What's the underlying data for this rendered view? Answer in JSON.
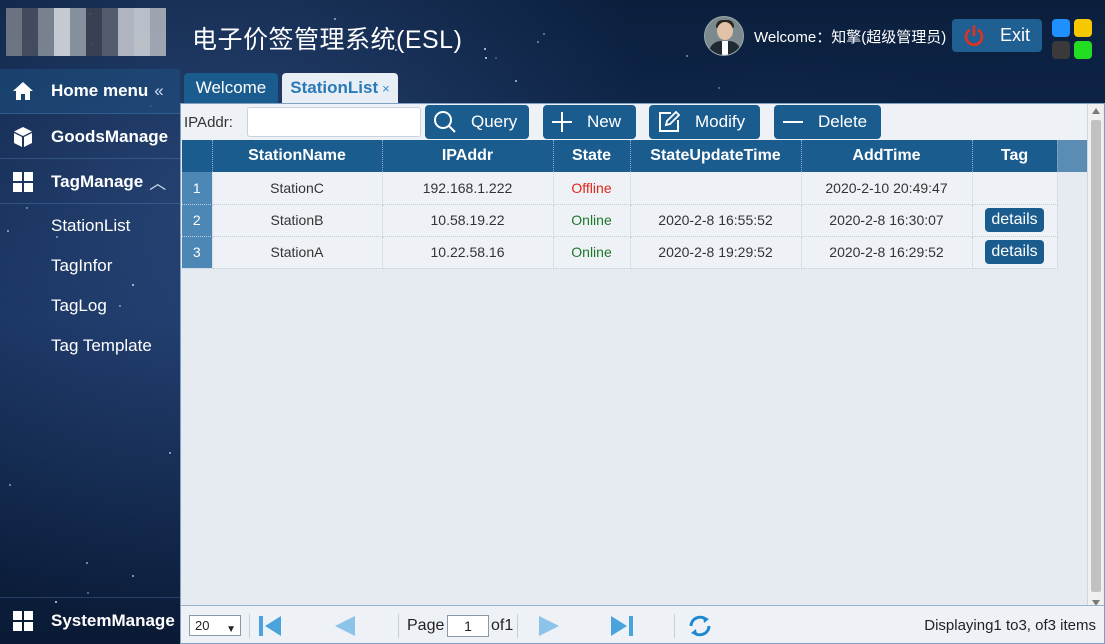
{
  "header": {
    "app_title": "电子价签管理系统(ESL)",
    "welcome_text": "Welcome：知擎(超级管理员)",
    "exit_label": "Exit",
    "theme_colors": [
      "#1e90ff",
      "#f7c800",
      "#3a3a3a",
      "#22dd22"
    ]
  },
  "sidebar": {
    "home_label": "Home menu",
    "home_arrow": "«",
    "goods_label": "GoodsManage",
    "tag_label": "TagManage",
    "tag_arrow": "︿",
    "sub_items": [
      "StationList",
      "TagInfor",
      "TagLog",
      "Tag Template"
    ],
    "system_label": "SystemManage"
  },
  "tabs": {
    "welcome": "Welcome",
    "active": "StationList",
    "close_glyph": "×"
  },
  "toolbar": {
    "ipaddr_label": "IPAddr:",
    "ipaddr_value": "",
    "query_label": "Query",
    "new_label": "New",
    "modify_label": "Modify",
    "delete_label": "Delete"
  },
  "table": {
    "columns": [
      "StationName",
      "IPAddr",
      "State",
      "StateUpdateTime",
      "AddTime",
      "Tag"
    ],
    "rows": [
      {
        "num": "1",
        "name": "StationC",
        "ip": "192.168.1.222",
        "state": "Offline",
        "state_update": "",
        "add_time": "2020-2-10 20:49:47",
        "tag": ""
      },
      {
        "num": "2",
        "name": "StationB",
        "ip": "10.58.19.22",
        "state": "Online",
        "state_update": "2020-2-8 16:55:52",
        "add_time": "2020-2-8 16:30:07",
        "tag": "details"
      },
      {
        "num": "3",
        "name": "StationA",
        "ip": "10.22.58.16",
        "state": "Online",
        "state_update": "2020-2-8 19:29:52",
        "add_time": "2020-2-8 16:29:52",
        "tag": "details"
      }
    ]
  },
  "pager": {
    "page_size": "20",
    "page_label": "Page",
    "page_value": "1",
    "of_label": "of1",
    "info": "Displaying1 to3, of3 items"
  }
}
